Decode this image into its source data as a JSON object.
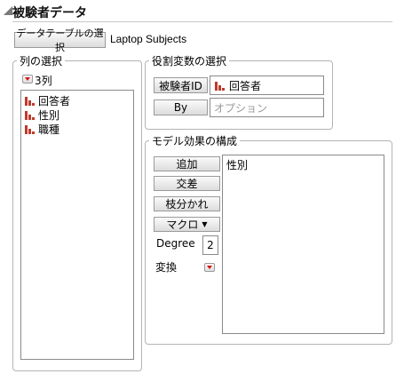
{
  "title": "被験者データ",
  "table_select": {
    "button_label": "データテーブルの選択",
    "table_name": "Laptop Subjects"
  },
  "column_select": {
    "label": "列の選択",
    "count_label": "3列",
    "items": [
      {
        "label": "回答者",
        "icon": "nominal-bar-icon"
      },
      {
        "label": "性別",
        "icon": "nominal-bar-icon"
      },
      {
        "label": "職種",
        "icon": "nominal-bar-icon"
      }
    ]
  },
  "role_vars": {
    "label": "役割変数の選択",
    "subject_id_button": "被験者ID",
    "subject_id_value": "回答者",
    "by_button": "By",
    "by_placeholder": "オプション"
  },
  "model_effects": {
    "label": "モデル効果の構成",
    "add_button": "追加",
    "cross_button": "交差",
    "nest_button": "枝分かれ",
    "macro_button": "マクロ",
    "degree_label": "Degree",
    "degree_value": "2",
    "transform_label": "変換",
    "effects": [
      "性別"
    ]
  },
  "colors": {
    "icon_red": "#c0392b",
    "dropdown_red": "#dd1111"
  }
}
